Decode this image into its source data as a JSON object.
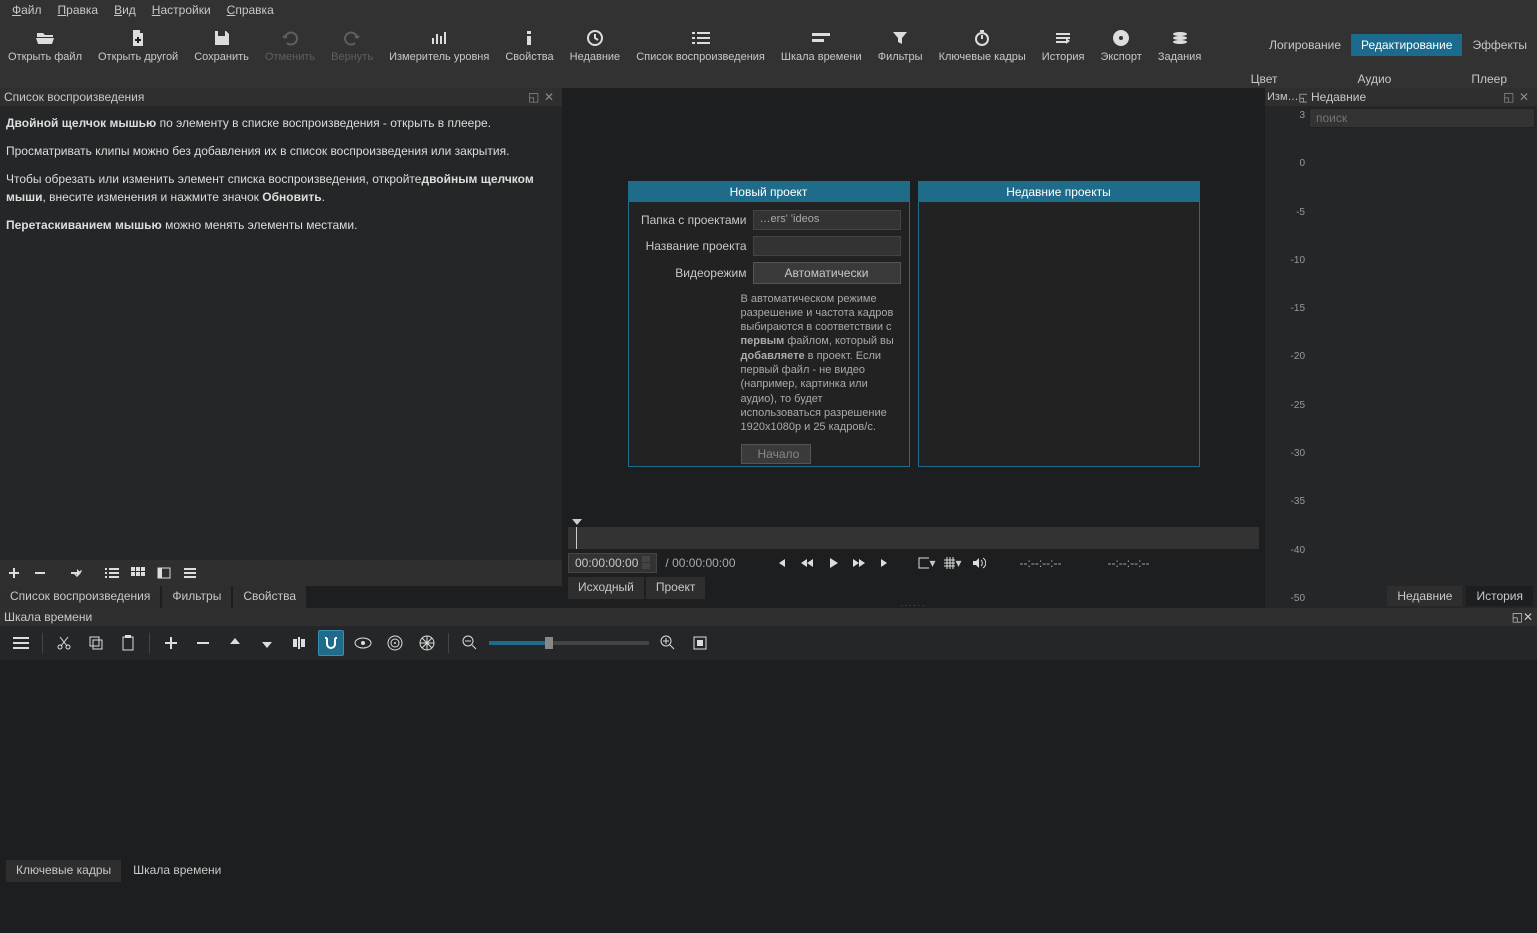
{
  "menu": {
    "items": [
      "Файл",
      "Правка",
      "Вид",
      "Настройки",
      "Справка"
    ]
  },
  "toolbar": {
    "open": "Открыть файл",
    "open_other": "Открыть другой",
    "save": "Сохранить",
    "undo": "Отменить",
    "redo": "Вернуть",
    "meter": "Измеритель уровня",
    "properties": "Свойства",
    "recent": "Недавние",
    "playlist": "Список воспроизведения",
    "timeline": "Шкала времени",
    "filters": "Фильтры",
    "keyframes": "Ключевые кадры",
    "history": "История",
    "export": "Экспорт",
    "jobs": "Задания"
  },
  "layout_tabs": {
    "logging": "Логирование",
    "editing": "Редактирование",
    "effects": "Эффекты"
  },
  "second_row": {
    "color": "Цвет",
    "audio": "Аудио",
    "player": "Плеер"
  },
  "playlist_panel": {
    "title": "Список воспроизведения",
    "help1a": "Двойной щелчок мышью",
    "help1b": " по элементу в списке воспроизведения - открыть в плеере.",
    "help2": "Просматривать клипы можно без добавления их в список воспроизведения или закрытия.",
    "help3a": "Чтобы обрезать или изменить элемент списка воспроизведения, откройте",
    "help3b": "двойным щелчком мыши",
    "help3c": ", внесите изменения и нажмите значок ",
    "help3d": "Обновить",
    "help4a": "Перетаскиванием мышью",
    "help4b": " можно менять элементы местами.",
    "tabs": {
      "playlist": "Список воспроизведения",
      "filters": "Фильтры",
      "properties": "Свойства"
    }
  },
  "meter_panel": {
    "title": "Изм…",
    "ticks": [
      "3",
      "0",
      "-5",
      "-10",
      "-15",
      "-20",
      "-25",
      "-30",
      "-35",
      "-40",
      "-50"
    ]
  },
  "recent_panel": {
    "title": "Недавние",
    "search_ph": "поиск",
    "tabs": {
      "recent": "Недавние",
      "history": "История"
    }
  },
  "new_project": {
    "title": "Новый проект",
    "folder_lbl": "Папка с проектами",
    "folder_val": "…ers'                       'ideos",
    "name_lbl": "Название проекта",
    "name_val": "",
    "mode_lbl": "Видеорежим",
    "mode_val": "Автоматически",
    "info_a": "В автоматическом режиме разрешение и частота кадров выбираются в соответствии с ",
    "info_b": "первым",
    "info_c": " файлом, который вы ",
    "info_d": "добавляете",
    "info_e": " в проект. Если первый файл - не видео (например, картинка или аудио), то будет использоваться разрешение 1920x1080p и 25 кадров/с.",
    "start": "Начало"
  },
  "recent_projects": {
    "title": "Недавние проекты"
  },
  "player": {
    "tc_cur": "00:00:00:00",
    "tc_sep": "/",
    "tc_total": "00:00:00:00",
    "dash1": "--:--:--:--",
    "dash2": "--:--:--:--",
    "tabs": {
      "source": "Исходный",
      "project": "Проект"
    }
  },
  "timeline": {
    "title": "Шкала времени",
    "tabs": {
      "keyframes": "Ключевые кадры",
      "timeline": "Шкала времени"
    }
  }
}
